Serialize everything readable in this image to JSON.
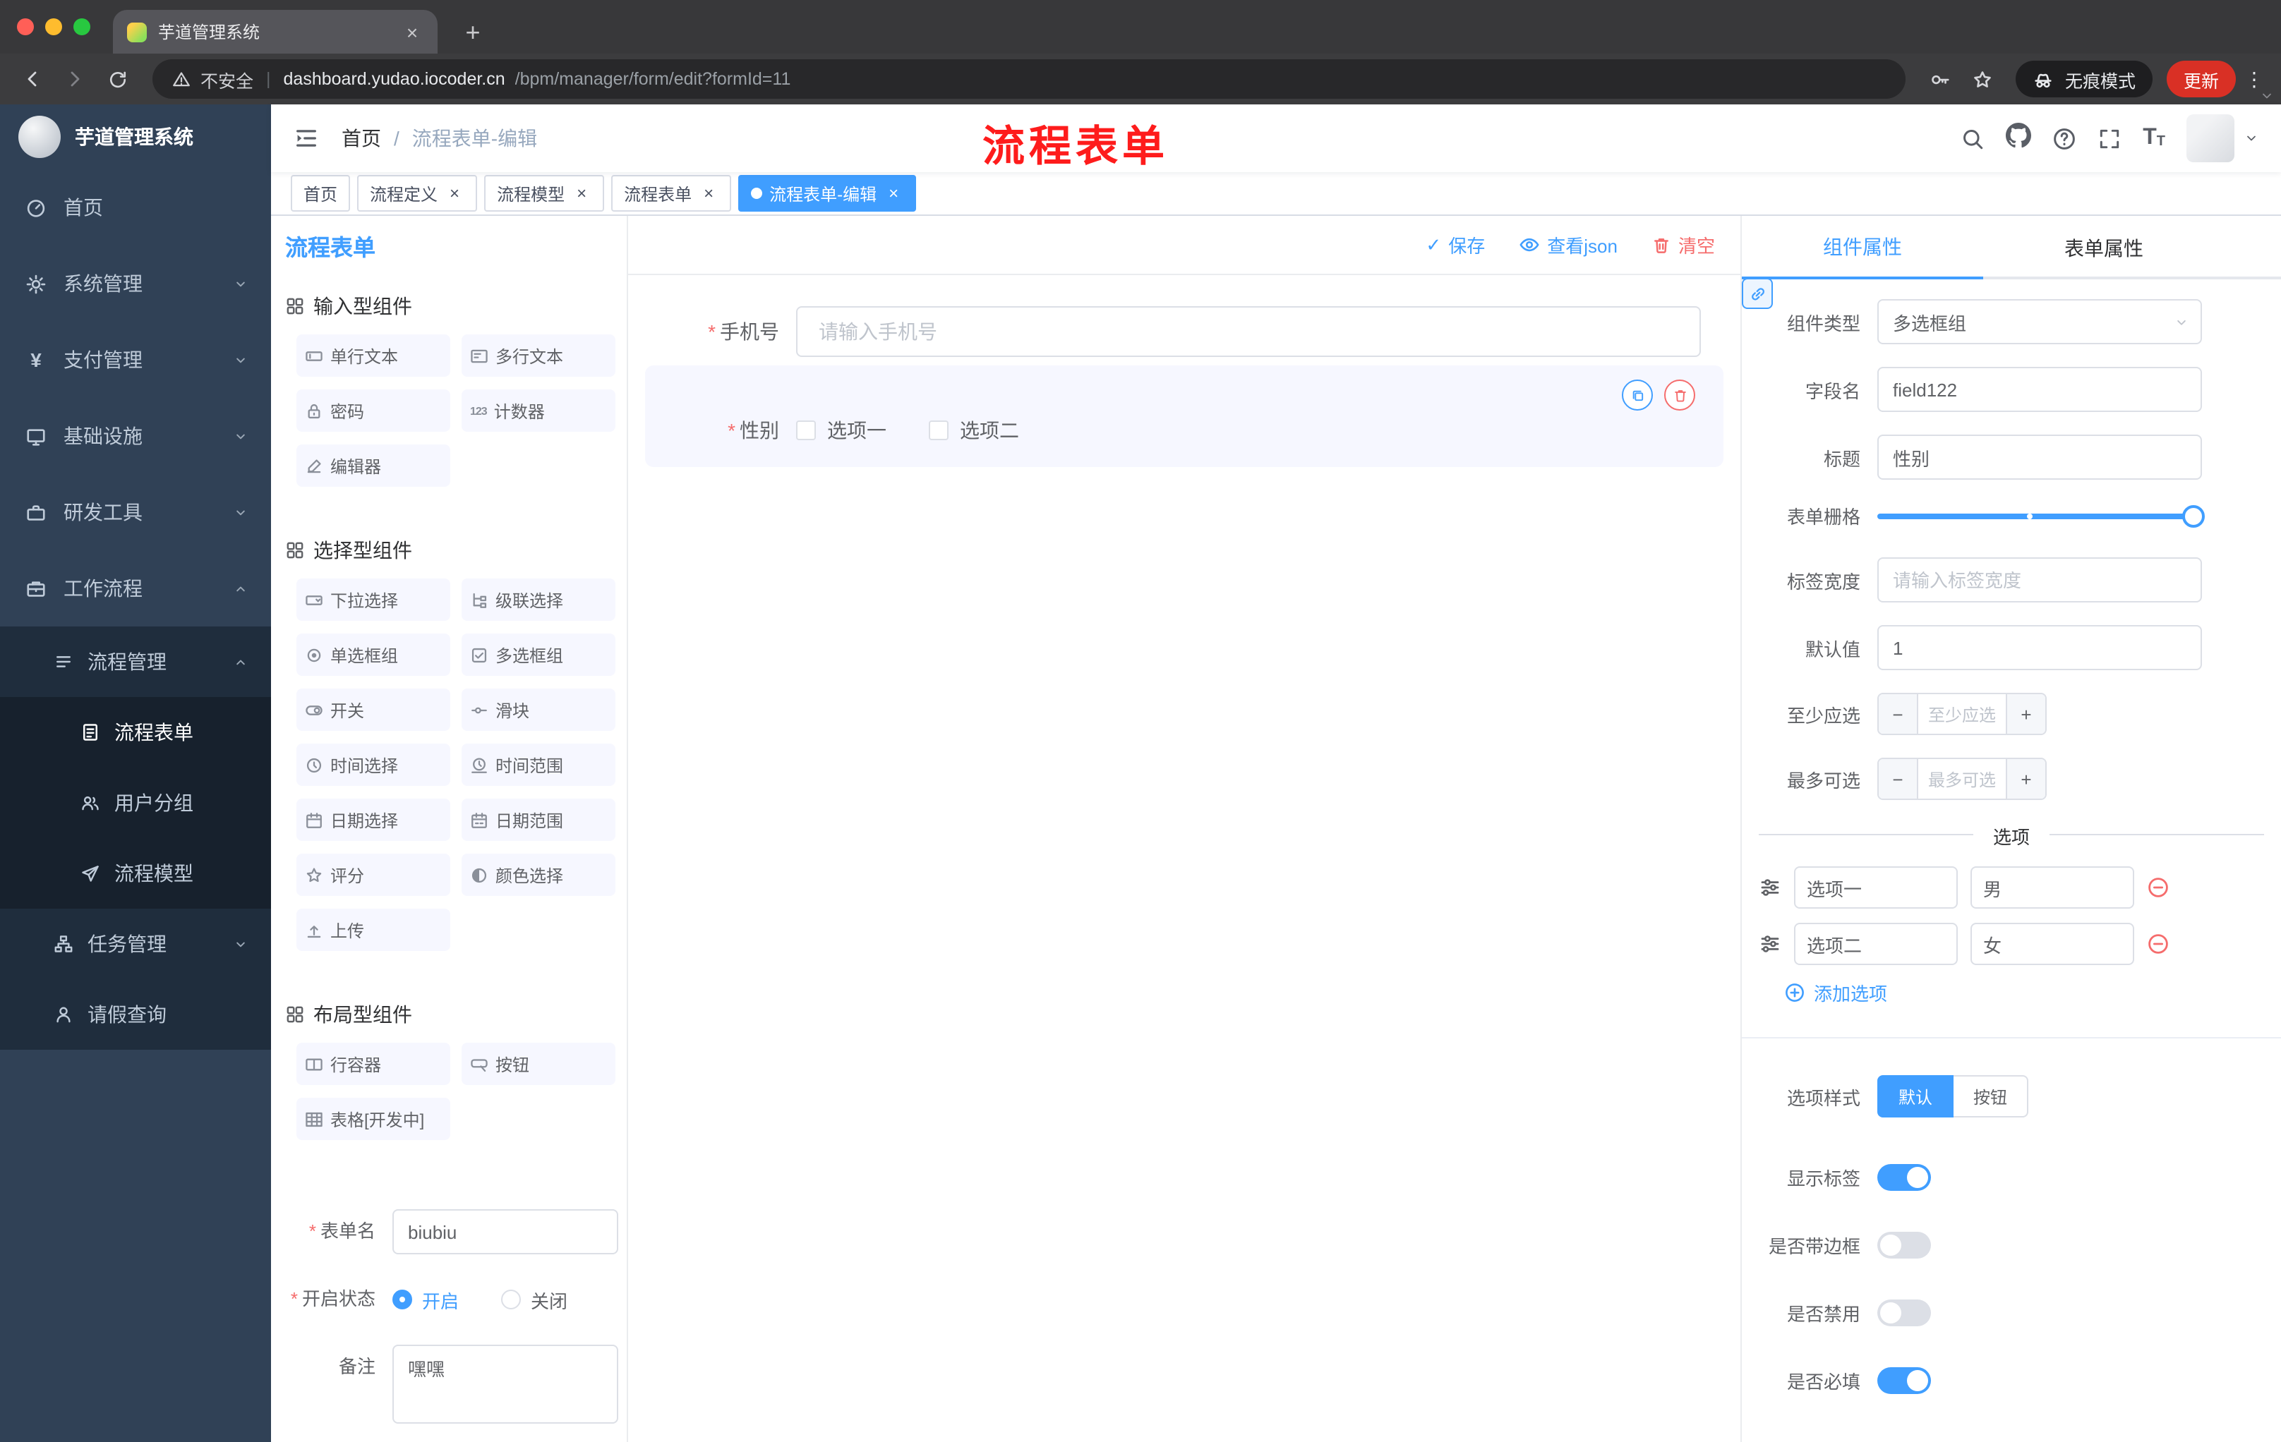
{
  "colors": {
    "accent": "#409eff",
    "danger": "#f56c6c",
    "active_tag": "#409eff",
    "update_button": "#d93025",
    "annotation_red": "#fe1c1c",
    "sidebar_bg": "#304156"
  },
  "glyphs": {
    "close": "×",
    "plus": "+",
    "check": "✓",
    "minus": "−",
    "dots": "⋮",
    "slash": "/",
    "pipe": "|",
    "asterisk": "*",
    "counter_icon": "123",
    "yen": "¥",
    "font_big": "T",
    "font_small": "T"
  },
  "browser": {
    "tab_title": "芋道管理系统",
    "security_label": "不安全",
    "url_host": "dashboard.yudao.iocoder.cn",
    "url_path": "/bpm/manager/form/edit?formId=11",
    "incognito_label": "无痕模式",
    "update_label": "更新"
  },
  "sidebar": {
    "logo_title": "芋道管理系统",
    "items": {
      "home": "首页",
      "system": "系统管理",
      "payment": "支付管理",
      "infra": "基础设施",
      "devtools": "研发工具",
      "workflow": "工作流程",
      "process_mgmt": "流程管理",
      "process_form": "流程表单",
      "user_group": "用户分组",
      "process_model": "流程模型",
      "task_mgmt": "任务管理",
      "leave_query": "请假查询"
    }
  },
  "navbar": {
    "breadcrumb": {
      "home": "首页",
      "current": "流程表单-编辑"
    },
    "annotation": "流程表单"
  },
  "tags": {
    "t0": "首页",
    "t1": "流程定义",
    "t2": "流程模型",
    "t3": "流程表单",
    "t4": "流程表单-编辑"
  },
  "designer": {
    "panel_title": "流程表单",
    "toolbar": {
      "save": "保存",
      "view_json": "查看json",
      "clear": "清空"
    },
    "palette": {
      "group_inputs": "输入型组件",
      "group_selects": "选择型组件",
      "group_layouts": "布局型组件",
      "items": {
        "single_text": "单行文本",
        "multi_text": "多行文本",
        "password": "密码",
        "counter": "计数器",
        "editor": "编辑器",
        "select": "下拉选择",
        "cascader": "级联选择",
        "radio_group": "单选框组",
        "checkbox_group": "多选框组",
        "switch": "开关",
        "slider": "滑块",
        "time": "时间选择",
        "time_range": "时间范围",
        "date": "日期选择",
        "date_range": "日期范围",
        "rate": "评分",
        "color": "颜色选择",
        "upload": "上传",
        "row": "行容器",
        "button": "按钮",
        "table": "表格[开发中]"
      }
    },
    "meta": {
      "name_label": "表单名",
      "name_value": "biubiu",
      "status_label": "开启状态",
      "status_on": "开启",
      "status_off": "关闭",
      "remark_label": "备注",
      "remark_value": "嘿嘿"
    }
  },
  "canvas": {
    "phone_label": "手机号",
    "phone_placeholder": "请输入手机号",
    "gender_label": "性别",
    "gender_opt1": "选项一",
    "gender_opt2": "选项二"
  },
  "props": {
    "tab_component": "组件属性",
    "tab_form": "表单属性",
    "component_type_label": "组件类型",
    "component_type_value": "多选框组",
    "field_name_label": "字段名",
    "field_name_value": "field122",
    "title_label": "标题",
    "title_value": "性别",
    "grid_label": "表单栅格",
    "label_width_label": "标签宽度",
    "label_width_placeholder": "请输入标签宽度",
    "default_label": "默认值",
    "default_value": "1",
    "min_label": "至少应选",
    "min_placeholder": "至少应选",
    "max_label": "最多可选",
    "max_placeholder": "最多可选",
    "options_divider": "选项",
    "opt1_label": "选项一",
    "opt1_value": "男",
    "opt2_label": "选项二",
    "opt2_value": "女",
    "add_option": "添加选项",
    "style_label": "选项样式",
    "style_default": "默认",
    "style_button": "按钮",
    "switch_show": "显示标签",
    "switch_border": "是否带边框",
    "switch_disabled": "是否禁用",
    "switch_required": "是否必填"
  }
}
